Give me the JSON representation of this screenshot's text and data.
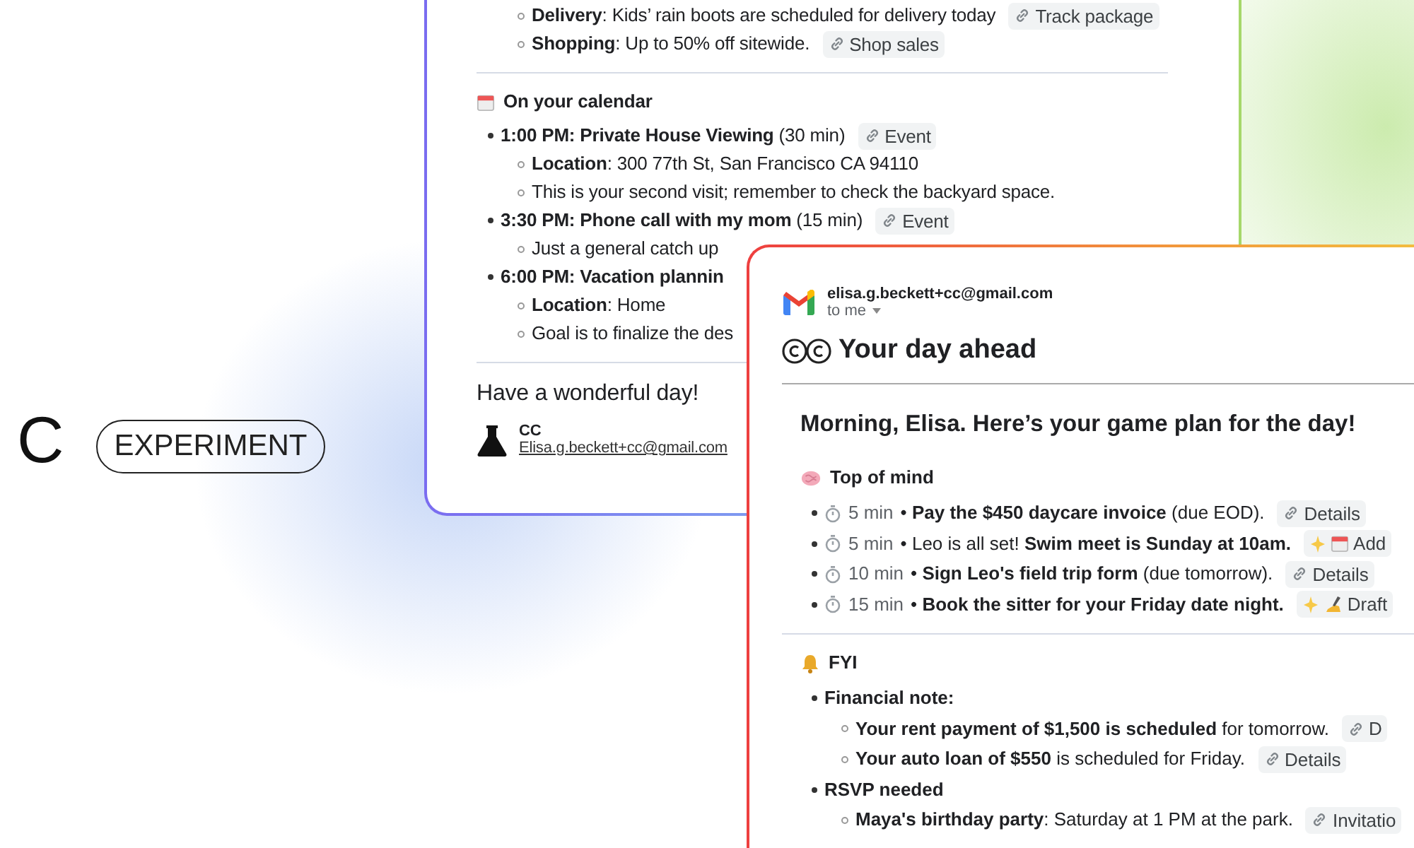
{
  "brand": {
    "name": "C",
    "badge": "EXPERIMENT"
  },
  "back_email": {
    "continued_items": [
      {
        "text": "**Delivery**: Kids’ rain boots are scheduled for delivery today",
        "chip": {
          "kind": "link",
          "label": "Track package"
        }
      },
      {
        "text": "**Shopping**: Up to 50% off sitewide.",
        "chip": {
          "kind": "link",
          "label": "Shop sales"
        }
      }
    ],
    "sections": [
      {
        "heading": "On your calendar",
        "items": [
          {
            "text": "**1:00 PM: Private House Viewing** (30 min)",
            "chip": {
              "kind": "link",
              "label": "Event"
            },
            "children": [
              {
                "text": "**Location**: 300 77th St, San Francisco CA 94110"
              },
              {
                "text": "This is your second visit; remember to check the backyard space."
              }
            ]
          },
          {
            "text": "**3:30 PM: Phone call with my mom** (15 min)",
            "chip": {
              "kind": "link",
              "label": "Event"
            },
            "children": [
              {
                "text": "Just a general catch up"
              }
            ]
          },
          {
            "text": "**6:00 PM: Vacation plannin**",
            "children": [
              {
                "text": "**Location**: Home"
              },
              {
                "text": "Goal is to finalize the des"
              }
            ]
          }
        ]
      }
    ],
    "closing": "Have a wonderful day!",
    "signature": {
      "name": "CC",
      "email": "Elisa.g.beckett+cc@gmail.com"
    }
  },
  "front_email": {
    "sender": "elisa.g.beckett+cc@gmail.com",
    "recipient": "to me",
    "subject": "Your day ahead",
    "greeting": "Morning, Elisa. Here’s your game plan for the day!",
    "sections": [
      {
        "heading": "Top of mind",
        "items": [
          {
            "duration": "5 min",
            "text": "• **Pay the $450 daycare invoice** (due EOD).",
            "chip": {
              "kind": "link",
              "label": "Details"
            }
          },
          {
            "duration": "5 min",
            "text": "• Leo is all set! **Swim meet is Sunday at 10am.**",
            "chip": {
              "kind": "add",
              "label": "Add"
            }
          },
          {
            "duration": "10 min",
            "text": "• **Sign Leo's field trip form** (due tomorrow).",
            "chip": {
              "kind": "link",
              "label": "Details"
            }
          },
          {
            "duration": "15 min",
            "text": "• **Book the sitter for your Friday date night.**",
            "chip": {
              "kind": "draft",
              "label": "Draft"
            }
          }
        ]
      },
      {
        "heading": "FYI",
        "items": [
          {
            "text": "**Financial note:**",
            "children": [
              {
                "text": "**Your rent payment of $1,500 is scheduled** for tomorrow.",
                "chip": {
                  "kind": "link",
                  "label": "D"
                }
              },
              {
                "text": "**Your auto loan of $550** is scheduled for Friday.",
                "chip": {
                  "kind": "link",
                  "label": "Details"
                }
              }
            ]
          },
          {
            "text": "**RSVP needed**",
            "children": [
              {
                "text": "**Maya's birthday party**: Saturday at 1 PM at the park.",
                "chip": {
                  "kind": "link",
                  "label": "Invitatio"
                }
              }
            ]
          }
        ]
      }
    ]
  }
}
